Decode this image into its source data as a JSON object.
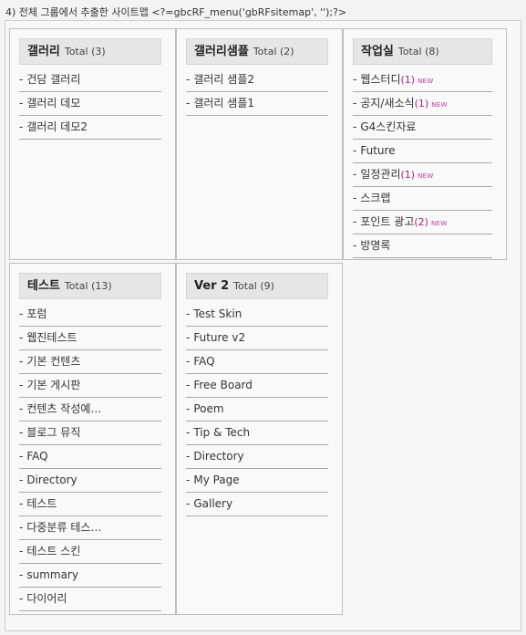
{
  "caption": "4) 전체 그룹에서 추출한 사이트맵 <?=gbcRF_menu('gbRFsitemap', '');?>",
  "groups": [
    {
      "title": "갤러리",
      "total": "Total (3)",
      "items": [
        {
          "label": "건담 갤러리"
        },
        {
          "label": "갤러리 데모"
        },
        {
          "label": "갤러리 데모2"
        }
      ]
    },
    {
      "title": "갤러리샘플",
      "total": "Total (2)",
      "items": [
        {
          "label": "갤러리 샘플2"
        },
        {
          "label": "갤러리 샘플1"
        }
      ]
    },
    {
      "title": "작업실",
      "total": "Total (8)",
      "items": [
        {
          "label": "웹스터디",
          "count": "(1)",
          "badge": "NEW"
        },
        {
          "label": "공지/새소식",
          "count": "(1)",
          "badge": "NEW"
        },
        {
          "label": "G4스킨자료"
        },
        {
          "label": "Future"
        },
        {
          "label": "일정관리",
          "count": "(1)",
          "badge": "NEW"
        },
        {
          "label": "스크랩"
        },
        {
          "label": "포인트 광고",
          "count": "(2)",
          "badge": "NEW"
        },
        {
          "label": "방명록"
        }
      ]
    },
    {
      "title": "테스트",
      "total": "Total (13)",
      "items": [
        {
          "label": "포럼"
        },
        {
          "label": "웹진테스트"
        },
        {
          "label": "기본 컨텐츠"
        },
        {
          "label": "기본 게시판"
        },
        {
          "label": "컨텐츠 작성예…"
        },
        {
          "label": "블로그 뮤직"
        },
        {
          "label": "FAQ"
        },
        {
          "label": "Directory"
        },
        {
          "label": "테스트"
        },
        {
          "label": "다중분류 테스…"
        },
        {
          "label": "테스트 스킨"
        },
        {
          "label": "summary"
        },
        {
          "label": "다이어리"
        }
      ]
    },
    {
      "title": "Ver 2",
      "total": "Total (9)",
      "items": [
        {
          "label": "Test Skin"
        },
        {
          "label": "Future v2"
        },
        {
          "label": "FAQ"
        },
        {
          "label": "Free Board"
        },
        {
          "label": "Poem"
        },
        {
          "label": "Tip & Tech"
        },
        {
          "label": "Directory"
        },
        {
          "label": "My Page"
        },
        {
          "label": "Gallery"
        }
      ]
    }
  ]
}
